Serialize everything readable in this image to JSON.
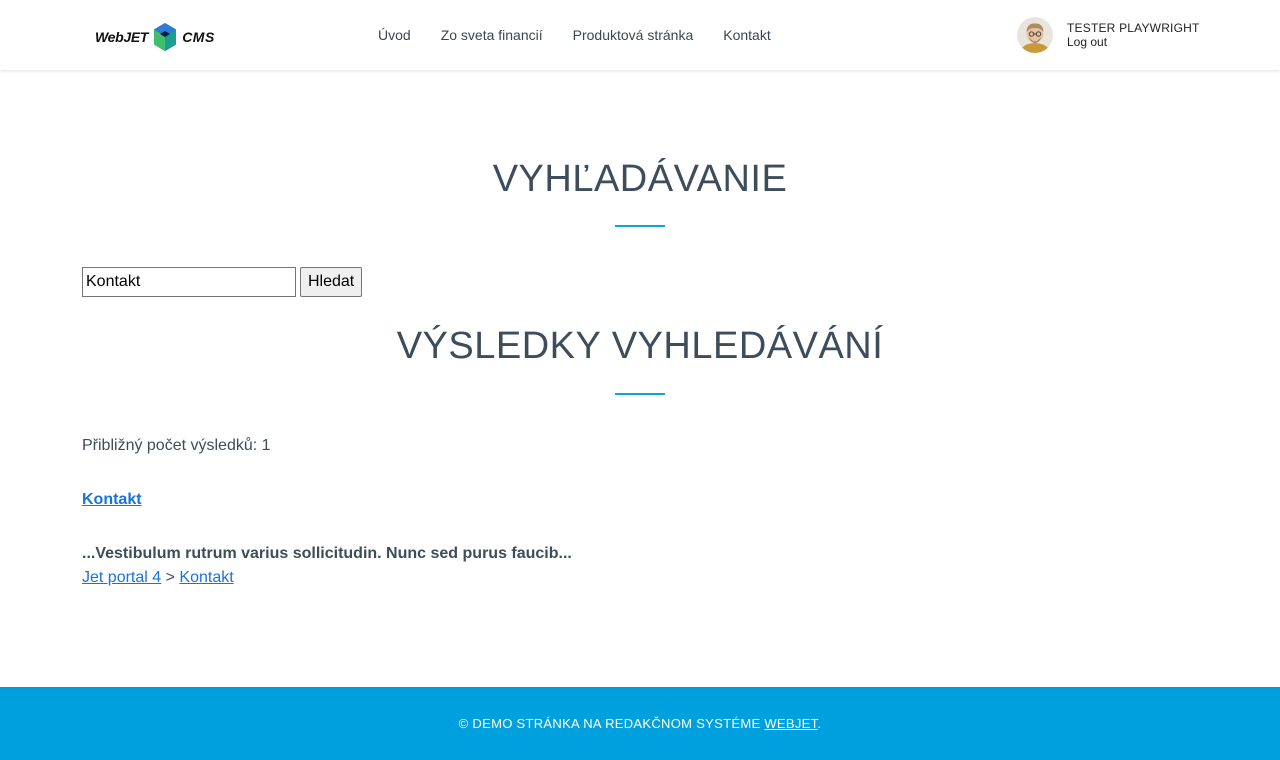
{
  "header": {
    "logo": {
      "left_text": "WebJET",
      "right_text": "CMS"
    },
    "nav": [
      "Úvod",
      "Zo sveta financií",
      "Produktová stránka",
      "Kontakt"
    ],
    "user": {
      "name": "TESTER PLAYWRIGHT",
      "logout": "Log out"
    }
  },
  "main": {
    "search_heading": "VYHĽADÁVANIE",
    "search": {
      "value": "Kontakt",
      "button": "Hledat"
    },
    "results_heading": "VÝSLEDKY VYHLEDÁVÁNÍ",
    "count_label": "Přibližný počet výsledků: 1",
    "results": [
      {
        "title": "Kontakt",
        "snippet": "...Vestibulum rutrum varius sollicitudin. Nunc sed purus faucib...",
        "breadcrumb": [
          "Jet portal 4",
          "Kontakt"
        ],
        "breadcrumb_separator": ">"
      }
    ]
  },
  "footer": {
    "text": "© DEMO STRÁNKA NA REDAKČNOM SYSTÉME ",
    "link": "WEBJET",
    "suffix": "."
  },
  "colors": {
    "accent": "#00a0de",
    "link": "#1a73d9",
    "heading": "#3d4d5a"
  }
}
